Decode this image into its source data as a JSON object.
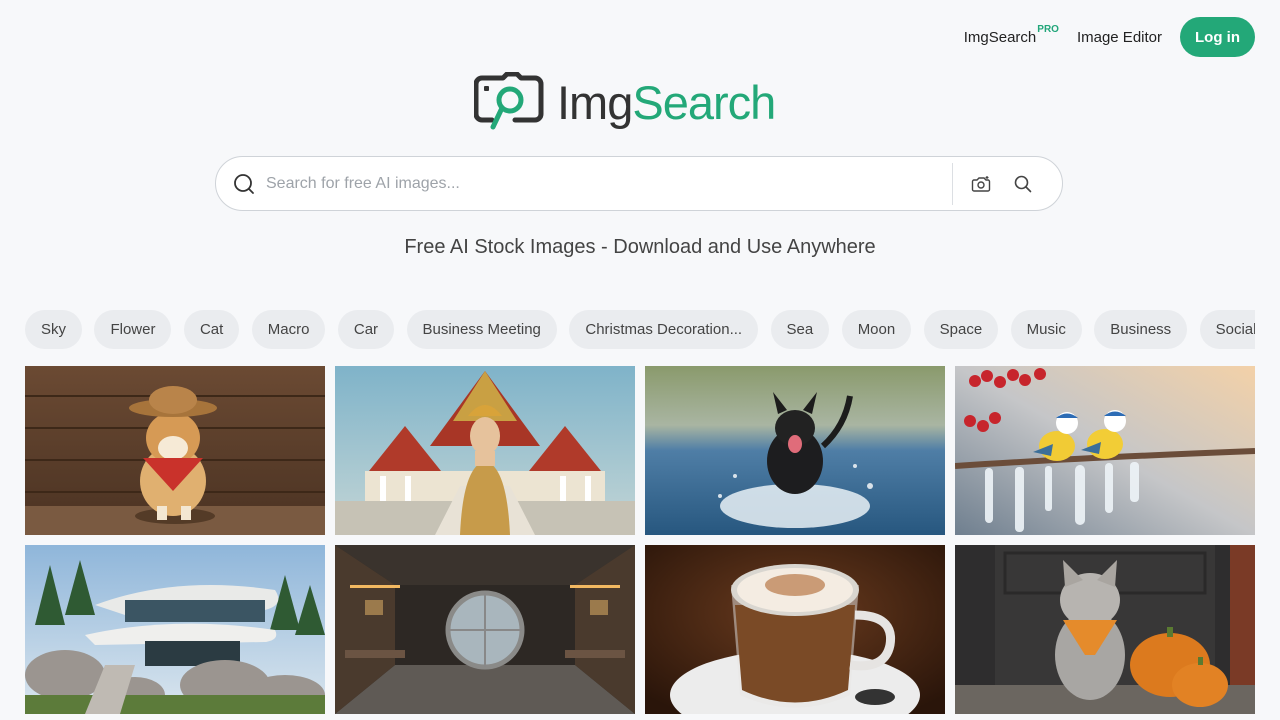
{
  "nav": {
    "pro_link": "ImgSearch",
    "pro_badge": "PRO",
    "editor_link": "Image Editor",
    "login_label": "Log in"
  },
  "logo": {
    "part1": "Img",
    "part2": "Search",
    "icon": "camera-magnifier-icon"
  },
  "search": {
    "placeholder": "Search for free AI images...",
    "value": "",
    "lead_icon": "search-icon",
    "camera_icon": "camera-search-icon",
    "submit_icon": "search-icon"
  },
  "subtitle": "Free AI Stock Images - Download and Use Anywhere",
  "categories": [
    "Sky",
    "Flower",
    "Cat",
    "Macro",
    "Car",
    "Business Meeting",
    "Christmas Decoration...",
    "Sea",
    "Moon",
    "Space",
    "Music",
    "Business",
    "Social Me"
  ],
  "colors": {
    "accent": "#23a878",
    "background": "#f7f8fa",
    "chip_bg": "#eaecef"
  }
}
